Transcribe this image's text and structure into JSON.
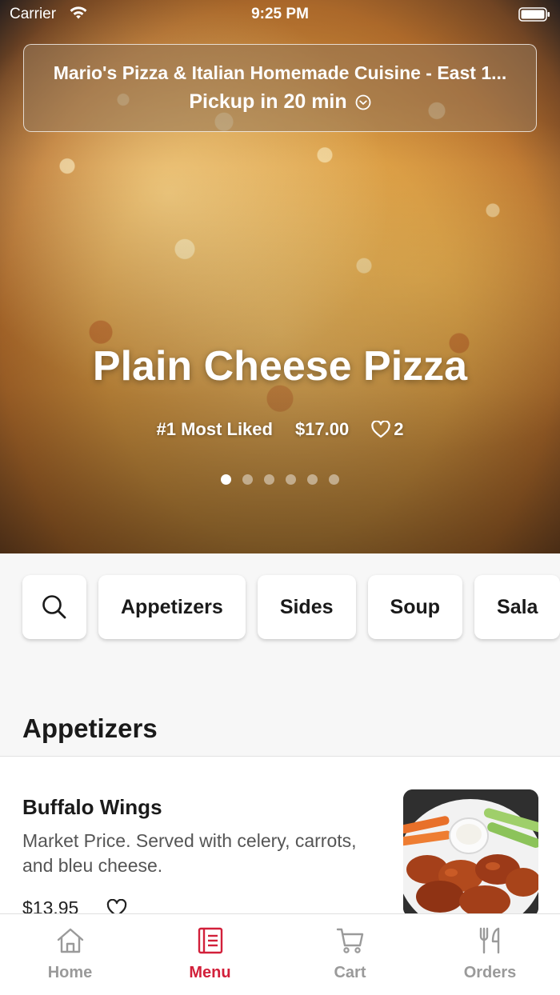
{
  "status_bar": {
    "carrier": "Carrier",
    "time": "9:25 PM"
  },
  "store": {
    "name": "Mario's Pizza & Italian Homemade Cuisine - East 1...",
    "pickup": "Pickup in 20 min"
  },
  "hero": {
    "title": "Plain Cheese Pizza",
    "rank": "#1 Most Liked",
    "price": "$17.00",
    "likes": "2",
    "carousel": {
      "slide_count": 6,
      "active_index": 0
    }
  },
  "categories": {
    "items": [
      {
        "label": "Appetizers"
      },
      {
        "label": "Sides"
      },
      {
        "label": "Soup"
      },
      {
        "label": "Sala"
      }
    ]
  },
  "section": {
    "title": "Appetizers"
  },
  "menu_items": [
    {
      "name": "Buffalo Wings",
      "description": "Market Price. Served with celery, carrots, and bleu cheese.",
      "price": "$13.95"
    }
  ],
  "tabbar": {
    "items": [
      {
        "label": "Home",
        "icon": "home-icon"
      },
      {
        "label": "Menu",
        "icon": "menu-icon"
      },
      {
        "label": "Cart",
        "icon": "cart-icon"
      },
      {
        "label": "Orders",
        "icon": "fork-knife-icon"
      }
    ],
    "active": "Menu"
  },
  "colors": {
    "accent": "#d2203a",
    "inactive": "#9a9a9a"
  }
}
